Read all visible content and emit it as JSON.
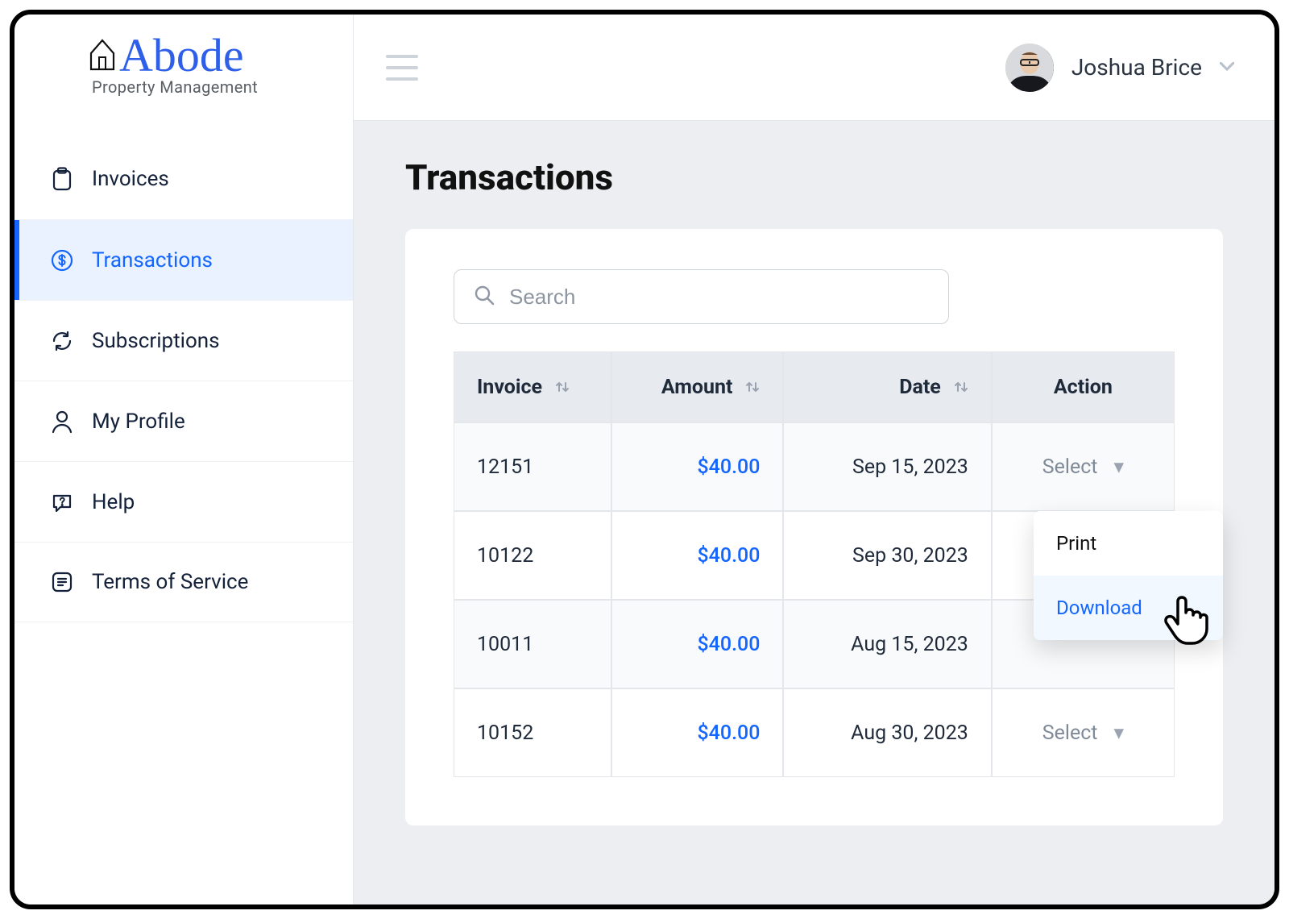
{
  "brand": {
    "name": "Abode",
    "tagline": "Property Management"
  },
  "user": {
    "name": "Joshua Brice"
  },
  "sidebar": {
    "items": [
      {
        "key": "invoices",
        "label": "Invoices",
        "icon": "clipboard-icon",
        "active": false
      },
      {
        "key": "transactions",
        "label": "Transactions",
        "icon": "dollar-circle-icon",
        "active": true
      },
      {
        "key": "subscriptions",
        "label": "Subscriptions",
        "icon": "refresh-icon",
        "active": false
      },
      {
        "key": "my-profile",
        "label": "My Profile",
        "icon": "person-icon",
        "active": false
      },
      {
        "key": "help",
        "label": "Help",
        "icon": "help-bubble-icon",
        "active": false
      },
      {
        "key": "terms",
        "label": "Terms of Service",
        "icon": "list-square-icon",
        "active": false
      }
    ]
  },
  "page": {
    "title": "Transactions",
    "search_placeholder": "Search"
  },
  "table": {
    "columns": {
      "invoice": "Invoice",
      "amount": "Amount",
      "date": "Date",
      "action": "Action"
    },
    "action_placeholder": "Select",
    "rows": [
      {
        "invoice": "12151",
        "amount": "$40.00",
        "date": "Sep 15, 2023"
      },
      {
        "invoice": "10122",
        "amount": "$40.00",
        "date": "Sep 30, 2023"
      },
      {
        "invoice": "10011",
        "amount": "$40.00",
        "date": "Aug 15, 2023"
      },
      {
        "invoice": "10152",
        "amount": "$40.00",
        "date": "Aug 30, 2023"
      }
    ]
  },
  "action_menu": {
    "items": [
      {
        "label": "Print",
        "active": false
      },
      {
        "label": "Download",
        "active": true
      }
    ],
    "open_for_row_index": 1
  },
  "colors": {
    "accent": "#1466ff",
    "muted": "#8d95a1"
  }
}
